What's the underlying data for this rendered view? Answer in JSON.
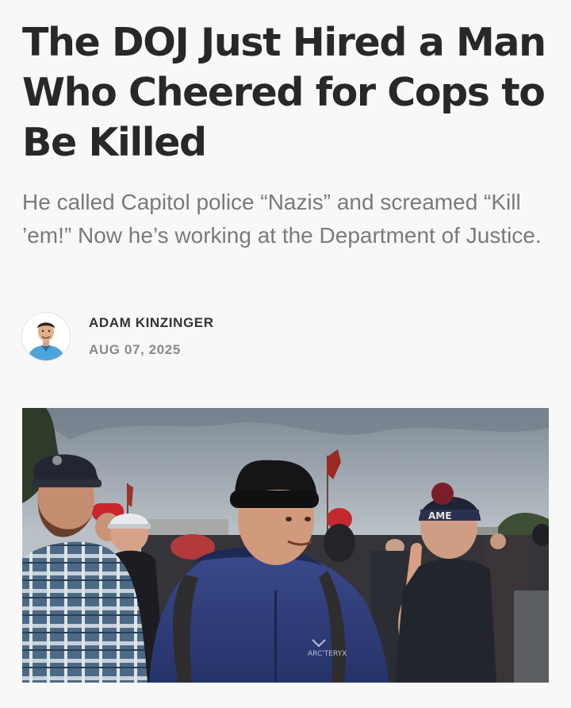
{
  "article": {
    "headline": "The DOJ Just Hired a Man Who Cheered for Cops to Be Killed",
    "subtitle": "He called Capitol police “Nazis” and screamed “Kill ’em!” Now he’s working at the Department of Justice.",
    "author": {
      "name": "ADAM KINZINGER",
      "date": "AUG 07, 2025",
      "avatar_icon": "author-portrait"
    },
    "hero_image": {
      "hat_text": "AME",
      "jacket_logo": "ARC'TERYX"
    }
  },
  "theme": {
    "background": "#f8f8f8",
    "headline_color": "#282828",
    "subtitle_color": "#7a7a7a",
    "author_color": "#333333",
    "date_color": "#8a8a8a"
  }
}
